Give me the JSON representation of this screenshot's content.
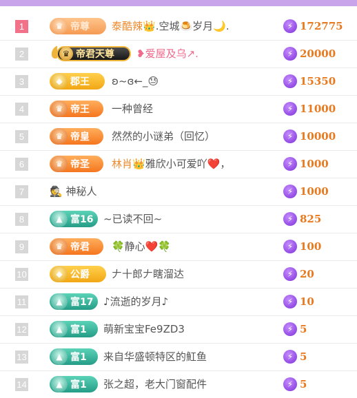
{
  "colors": {
    "accent_bar": "#c9a4ea",
    "amount": "#e8791e",
    "rank_first": "#f2728a",
    "rank_other": "#d7d7d7"
  },
  "rows": [
    {
      "rank": "1",
      "badge": "帝尊",
      "badge_style": "orange-faded",
      "name_hl": "泰酷辣",
      "name": "👑.空城🍮岁月🌙.",
      "amount": "172775"
    },
    {
      "rank": "2",
      "badge": "帝君天尊",
      "badge_style": "black",
      "name_pink": "❥爱屋及乌↗.",
      "name": "",
      "amount": "20000"
    },
    {
      "rank": "3",
      "badge": "郡王",
      "badge_style": "gold",
      "name": "ʚ~ɞ←_😓",
      "amount": "15350"
    },
    {
      "rank": "4",
      "badge": "帝王",
      "badge_style": "orange",
      "name": "一种曾经",
      "amount": "11000"
    },
    {
      "rank": "5",
      "badge": "帝皇",
      "badge_style": "orange",
      "name": "然然的小谜弟（回忆）",
      "amount": "10000"
    },
    {
      "rank": "6",
      "badge": "帝圣",
      "badge_style": "orange",
      "name_hl": "林肖",
      "name": "👑雅欣小可爱吖❤️，",
      "amount": "1000"
    },
    {
      "rank": "7",
      "badge": "",
      "badge_style": "none",
      "name": "🕵 神秘人",
      "amount": "1000"
    },
    {
      "rank": "8",
      "badge": "富16",
      "badge_style": "teal",
      "name": "~已读不回~",
      "amount": "825"
    },
    {
      "rank": "9",
      "badge": "帝君",
      "badge_style": "orange",
      "name": "🍀静心❤️🍀",
      "amount": "100"
    },
    {
      "rank": "10",
      "badge": "公爵",
      "badge_style": "gold",
      "name": "𠂇十郎𠂇瞎溜达",
      "amount": "20"
    },
    {
      "rank": "11",
      "badge": "富17",
      "badge_style": "teal",
      "name": "♪流逝的岁月♪",
      "amount": "10"
    },
    {
      "rank": "12",
      "badge": "富1",
      "badge_style": "teal",
      "name": "萌新宝宝Fe9ZD3",
      "amount": "5"
    },
    {
      "rank": "13",
      "badge": "富1",
      "badge_style": "teal",
      "name": "来自华盛顿特区的魟鱼",
      "amount": "5"
    },
    {
      "rank": "14",
      "badge": "富1",
      "badge_style": "teal",
      "name": "张之超，老大门窗配件",
      "amount": "5"
    }
  ]
}
